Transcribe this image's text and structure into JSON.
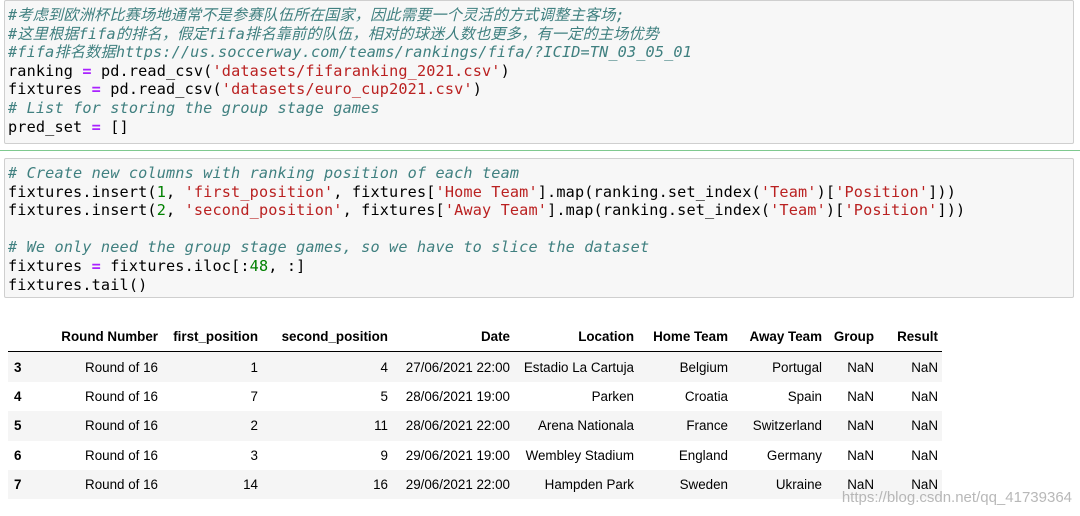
{
  "cell1": {
    "line1": "#考虑到欧洲杯比赛场地通常不是参赛队伍所在国家，因此需要一个灵活的方式调整主客场;",
    "line2": "#这里根据fifa的排名，假定fifa排名靠前的队伍，相对的球迷人数也更多，有一定的主场优势",
    "line3": "#fifa排名数据https://us.soccerway.com/teams/rankings/fifa/?ICID=TN_03_05_01",
    "line4": {
      "a": "ranking ",
      "op": "=",
      "b": " pd.read_csv(",
      "s": "'datasets/fifaranking_2021.csv'",
      "c": ")"
    },
    "line5": {
      "a": "fixtures ",
      "op": "=",
      "b": " pd.read_csv(",
      "s": "'datasets/euro_cup2021.csv'",
      "c": ")"
    },
    "line6": "# List for storing the group stage games",
    "line7": {
      "a": "pred_set ",
      "op": "=",
      "b": " []"
    }
  },
  "cell2": {
    "line1": "# Create new columns with ranking position of each team",
    "line2": {
      "a": "fixtures.insert(",
      "n": "1",
      "b": ", ",
      "s1": "'first_position'",
      "c": ", fixtures[",
      "s2": "'Home Team'",
      "d": "].map(ranking.set_index(",
      "s3": "'Team'",
      "e": ")[",
      "s4": "'Position'",
      "f": "]))"
    },
    "line3": {
      "a": "fixtures.insert(",
      "n": "2",
      "b": ", ",
      "s1": "'second_position'",
      "c": ", fixtures[",
      "s2": "'Away Team'",
      "d": "].map(ranking.set_index(",
      "s3": "'Team'",
      "e": ")[",
      "s4": "'Position'",
      "f": "]))"
    },
    "line5": "# We only need the group stage games, so we have to slice the dataset",
    "line6": {
      "a": "fixtures ",
      "op": "=",
      "b": " fixtures.iloc[:",
      "n": "48",
      "c": ", :]"
    },
    "line7": "fixtures.tail()"
  },
  "table": {
    "columns": [
      "",
      "Round Number",
      "first_position",
      "second_position",
      "Date",
      "Location",
      "Home Team",
      "Away Team",
      "Group",
      "Result"
    ],
    "rows": [
      [
        "3",
        "Round of 16",
        "1",
        "4",
        "27/06/2021 22:00",
        "Estadio La Cartuja",
        "Belgium",
        "Portugal",
        "NaN",
        "NaN"
      ],
      [
        "4",
        "Round of 16",
        "7",
        "5",
        "28/06/2021 19:00",
        "Parken",
        "Croatia",
        "Spain",
        "NaN",
        "NaN"
      ],
      [
        "5",
        "Round of 16",
        "2",
        "11",
        "28/06/2021 22:00",
        "Arena Nationala",
        "France",
        "Switzerland",
        "NaN",
        "NaN"
      ],
      [
        "6",
        "Round of 16",
        "3",
        "9",
        "29/06/2021 19:00",
        "Wembley Stadium",
        "England",
        "Germany",
        "NaN",
        "NaN"
      ],
      [
        "7",
        "Round of 16",
        "14",
        "16",
        "29/06/2021 22:00",
        "Hampden Park",
        "Sweden",
        "Ukraine",
        "NaN",
        "NaN"
      ]
    ]
  },
  "watermark": "https://blog.csdn.net/qq_41739364",
  "colors": {
    "comment": "#408080",
    "string": "#ba2121",
    "number": "#008000",
    "operator": "#aa22ff",
    "cell_bg": "#f7f7f7"
  }
}
